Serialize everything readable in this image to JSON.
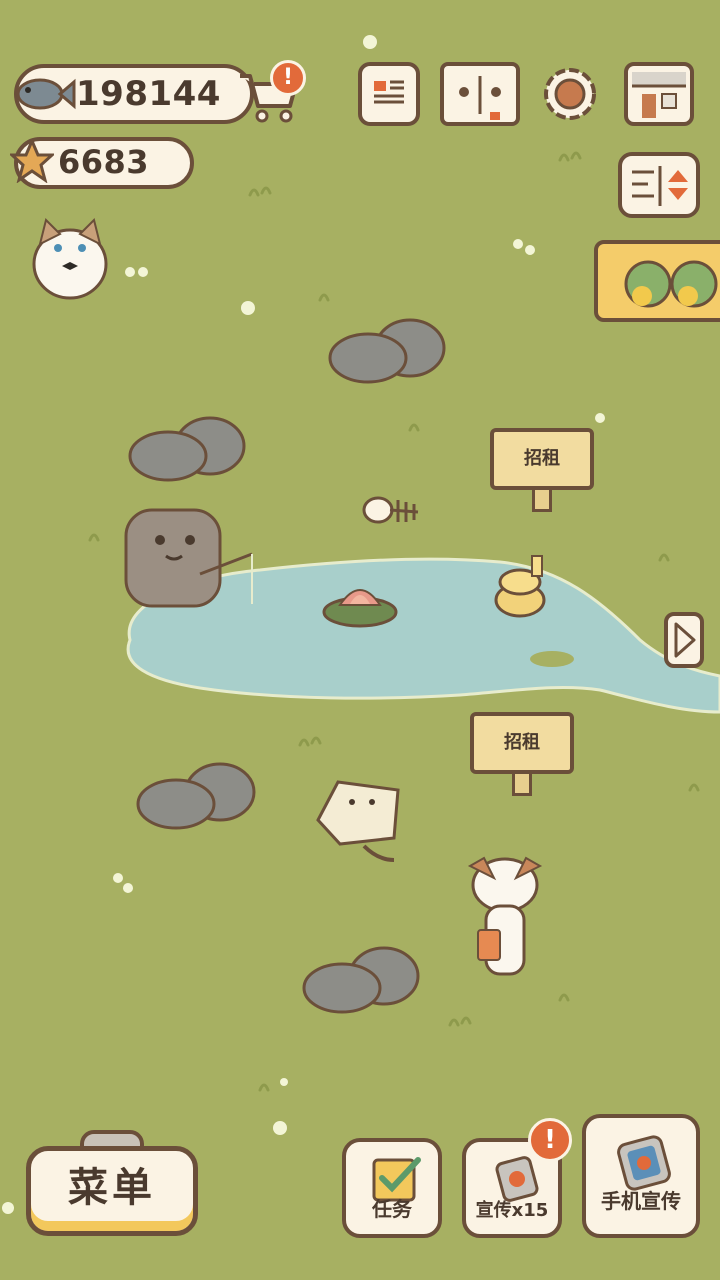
{
  "currency": {
    "fish_value": "198144",
    "star_value": "6683"
  },
  "badges": {
    "shop_alert": "!",
    "promo_alert": "!"
  },
  "signs": [
    {
      "label": "招租"
    },
    {
      "label": "招租"
    }
  ],
  "bottom_bar": {
    "menu_label": "菜单",
    "tasks_label": "任务",
    "promo_label": "宣传x15",
    "phone_promo_label": "手机宣传"
  },
  "icons": {
    "fish": "fish-icon",
    "star": "star-icon",
    "cart": "shopping-cart-icon",
    "newspaper": "newspaper-icon",
    "book": "paw-book-icon",
    "settings": "gear-icon",
    "store": "storefront-icon",
    "sort": "sort-toggle-icon",
    "next": "chevron-right-icon"
  },
  "colors": {
    "grass": "#a7b062",
    "pond": "#a8cfcb",
    "outline": "#6b4f3a",
    "panel": "#fbf3e4",
    "accent_yellow": "#f3c85c",
    "alert": "#e26a3a"
  }
}
